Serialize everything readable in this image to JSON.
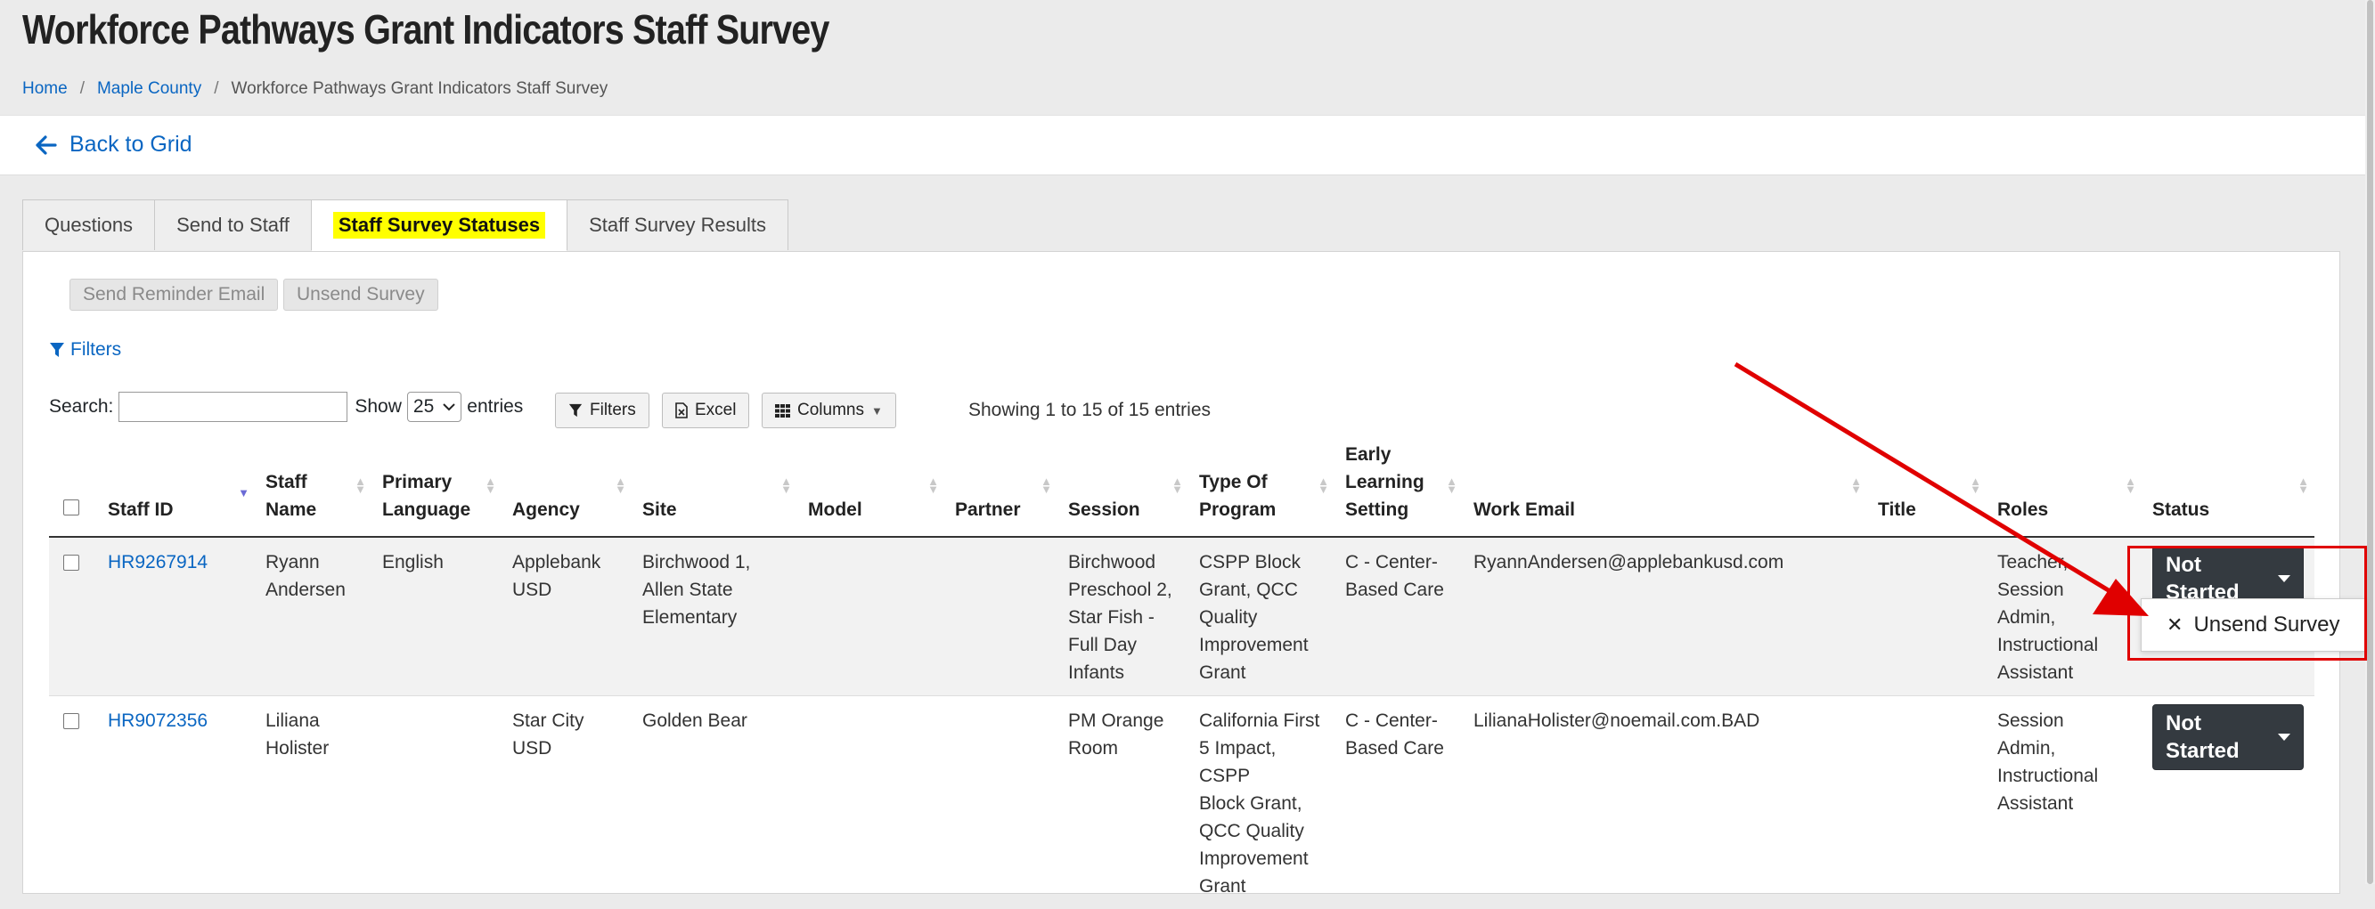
{
  "page": {
    "title": "Workforce Pathways Grant Indicators Staff Survey"
  },
  "breadcrumb": {
    "home": "Home",
    "county": "Maple County",
    "current": "Workforce Pathways Grant Indicators Staff Survey"
  },
  "back": {
    "label": "Back to Grid"
  },
  "tabs": [
    {
      "label": "Questions"
    },
    {
      "label": "Send to Staff"
    },
    {
      "label": "Staff Survey Statuses"
    },
    {
      "label": "Staff Survey Results"
    }
  ],
  "actions": {
    "send_reminder": "Send Reminder Email",
    "unsend": "Unsend Survey"
  },
  "filters_link": "Filters",
  "toolbar": {
    "search_label": "Search:",
    "show_label": "Show",
    "show_value": "25",
    "entries_label": "entries",
    "filters": "Filters",
    "excel": "Excel",
    "columns": "Columns",
    "showing": "Showing 1 to 15 of 15 entries"
  },
  "table": {
    "headers": {
      "staff_id": "Staff ID",
      "staff_name_1": "Staff",
      "staff_name_2": "Name",
      "primary_language_1": "Primary",
      "primary_language_2": "Language",
      "agency": "Agency",
      "site": "Site",
      "model": "Model",
      "partner": "Partner",
      "session": "Session",
      "type_of_program_1": "Type Of",
      "type_of_program_2": "Program",
      "early_learning_1": "Early",
      "early_learning_2": "Learning",
      "early_learning_3": "Setting",
      "work_email": "Work Email",
      "title": "Title",
      "roles": "Roles",
      "status": "Status"
    },
    "rows": [
      {
        "staff_id": "HR9267914",
        "name_1": "Ryann",
        "name_2": "Andersen",
        "language": "English",
        "agency_1": "Applebank",
        "agency_2": "USD",
        "site_1": "Birchwood 1,",
        "site_2": "Allen State",
        "site_3": "Elementary",
        "model": "",
        "partner": "",
        "session_1": "Birchwood",
        "session_2": "Preschool 2,",
        "session_3": "Star Fish -",
        "session_4": "Full Day",
        "session_5": "Infants",
        "program_1": "CSPP Block",
        "program_2": "Grant, QCC",
        "program_3": "Quality",
        "program_4": "Improvement",
        "program_5": "Grant",
        "setting_1": "C - Center-",
        "setting_2": "Based Care",
        "email": "RyannAndersen@applebankusd.com",
        "title": "",
        "roles_1": "Teacher,",
        "roles_2": "Session",
        "roles_3": "Admin,",
        "roles_4": "Instructional",
        "roles_5": "Assistant",
        "status": "Not Started"
      },
      {
        "staff_id": "HR9072356",
        "name_1": "Liliana",
        "name_2": "Holister",
        "language": "",
        "agency_1": "Star City",
        "agency_2": "USD",
        "site_1": "Golden Bear",
        "model": "",
        "partner": "",
        "session_1": "PM Orange",
        "session_2": "Room",
        "program_1": "California First",
        "program_2": "5 Impact, CSPP",
        "program_3": "Block Grant,",
        "program_4": "QCC Quality",
        "program_5": "Improvement",
        "program_6": "Grant",
        "setting_1": "C - Center-",
        "setting_2": "Based Care",
        "email": "LilianaHolister@noemail.com.BAD",
        "title": "",
        "roles_1": "Session",
        "roles_2": "Admin,",
        "roles_3": "Instructional",
        "roles_4": "Assistant",
        "status": "Not Started"
      }
    ]
  },
  "dropdown": {
    "item": "Unsend Survey",
    "icon": "times-icon"
  },
  "colors": {
    "link": "#0a66c2",
    "highlight": "#ffff00",
    "status_button": "#343a40",
    "annotation": "#e00000"
  }
}
